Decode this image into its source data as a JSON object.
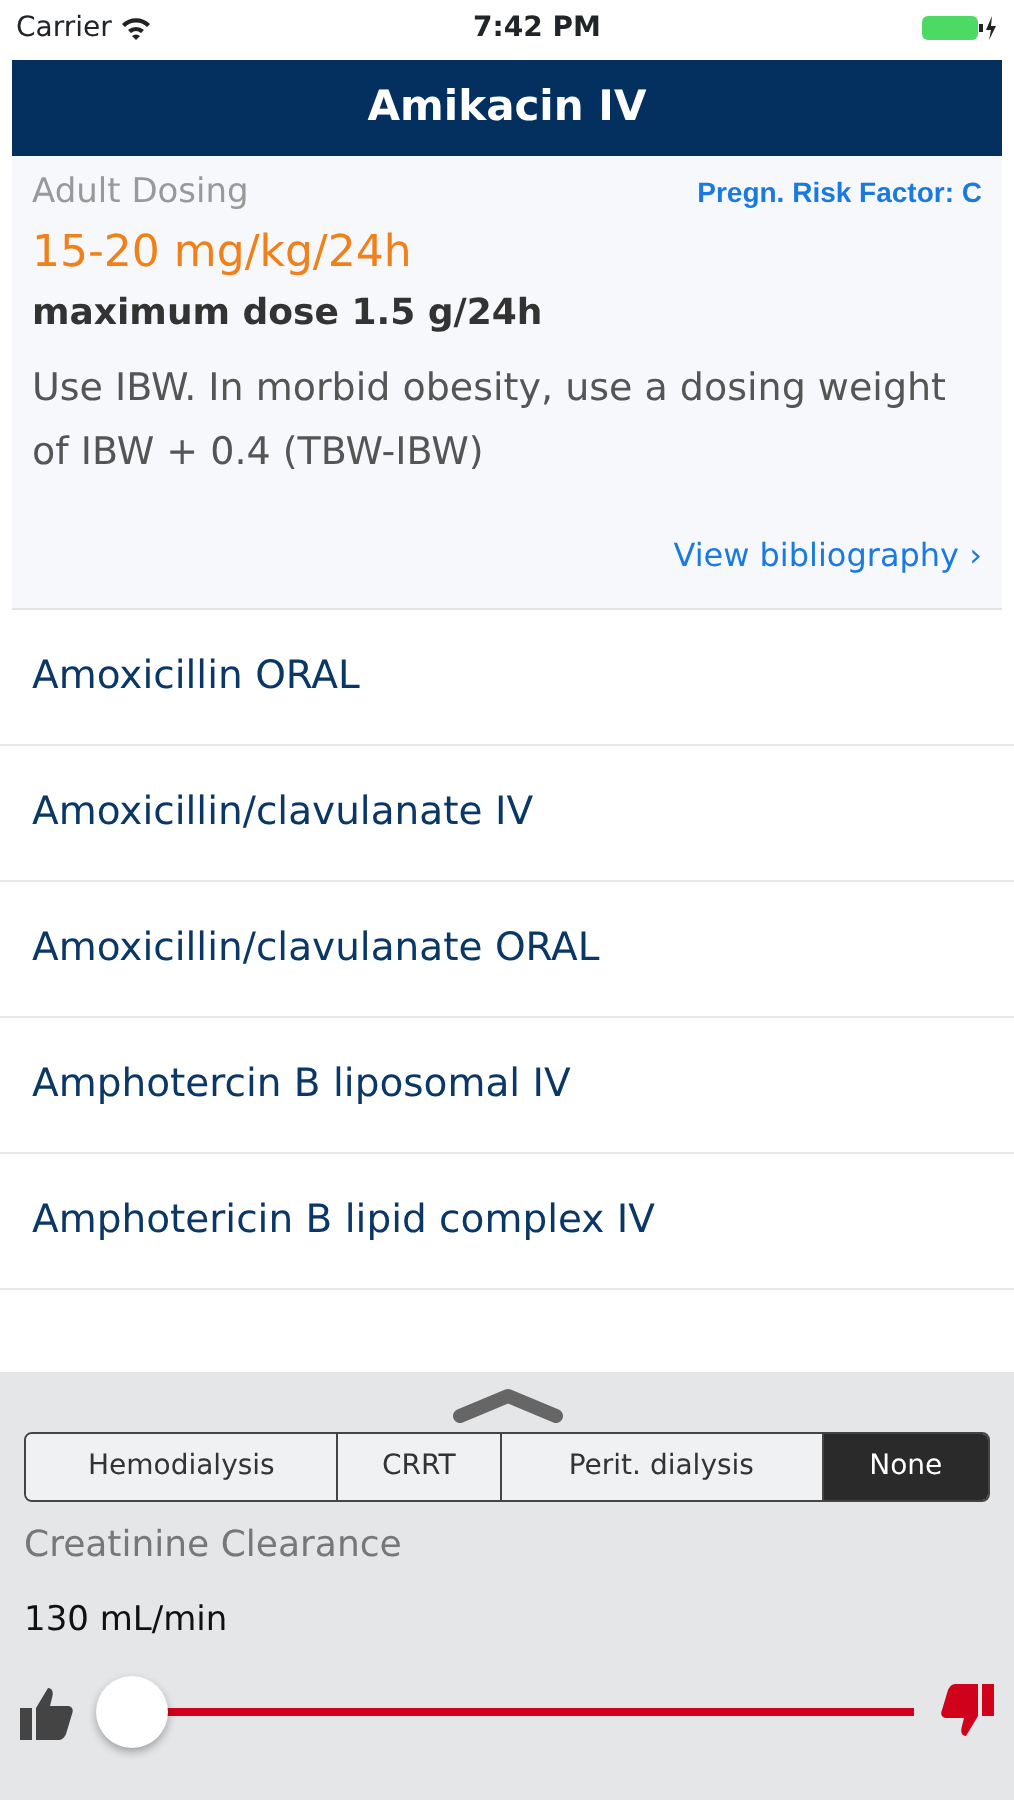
{
  "status_bar": {
    "carrier": "Carrier",
    "time": "7:42 PM"
  },
  "header": {
    "title": "Amikacin IV"
  },
  "detail": {
    "section": "Adult Dosing",
    "risk_factor": "Pregn. Risk Factor: C",
    "dose": "15-20 mg/kg/24h",
    "max_dose": "maximum dose 1.5 g/24h",
    "note": "Use IBW. In morbid obesity, use a dosing weight of IBW + 0.4 (TBW-IBW)",
    "bibliography_link": "View bibliography",
    "link_chevron": "›"
  },
  "drugs": [
    {
      "name": "Amoxicillin ORAL"
    },
    {
      "name": "Amoxicillin/clavulanate IV"
    },
    {
      "name": "Amoxicillin/clavulanate ORAL"
    },
    {
      "name": "Amphotercin B liposomal IV"
    },
    {
      "name": "Amphotericin B lipid complex IV"
    }
  ],
  "panel": {
    "dialysis_options": [
      {
        "label": "Hemodialysis",
        "selected": false
      },
      {
        "label": "CRRT",
        "selected": false
      },
      {
        "label": "Perit. dialysis",
        "selected": false
      },
      {
        "label": "None",
        "selected": true
      }
    ],
    "clearance_label": "Creatinine Clearance",
    "clearance_value": "130 mL/min",
    "slider": {
      "level": 0.02
    }
  }
}
